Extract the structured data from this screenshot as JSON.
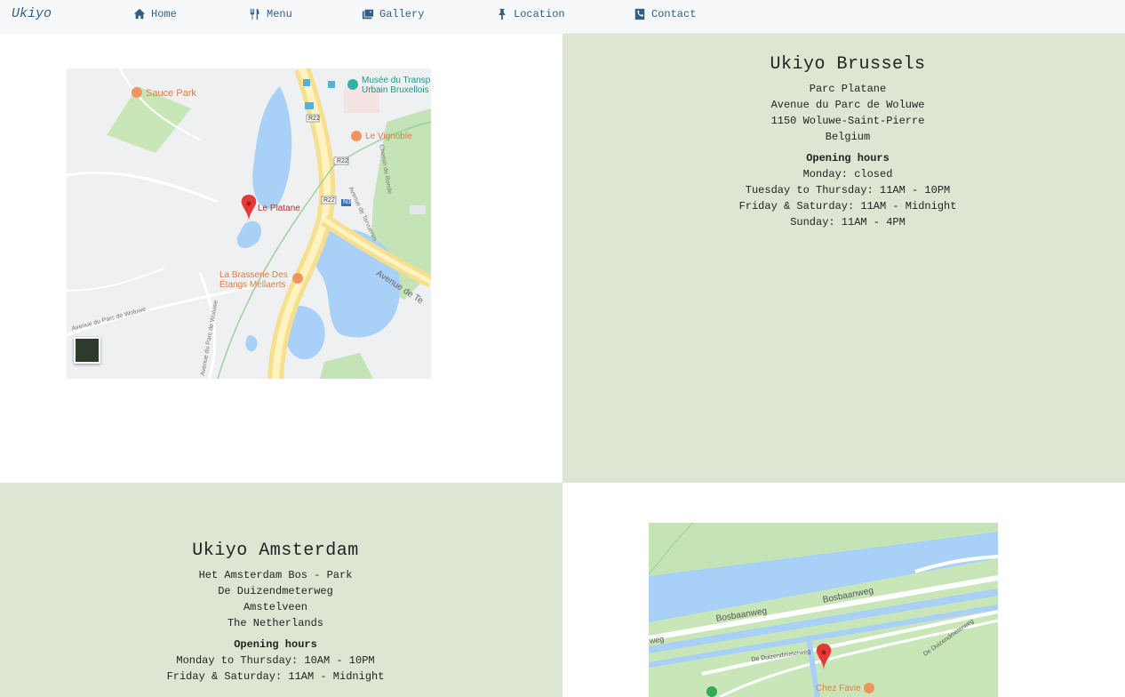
{
  "nav": {
    "brand": "Ukiyo",
    "items": [
      {
        "label": "Home",
        "icon": "home-icon"
      },
      {
        "label": "Menu",
        "icon": "utensils-icon"
      },
      {
        "label": "Gallery",
        "icon": "images-icon"
      },
      {
        "label": "Location",
        "icon": "pin-icon"
      },
      {
        "label": "Contact",
        "icon": "phone-icon"
      }
    ]
  },
  "brussels": {
    "title": "Ukiyo Brussels",
    "address": [
      "Parc Platane",
      "Avenue du Parc de Woluwe",
      "1150 Woluwe-Saint-Pierre",
      "Belgium"
    ],
    "hours_title": "Opening hours",
    "hours": [
      "Monday: closed",
      "Tuesday to Thursday: 11AM - 10PM",
      "Friday & Saturday: 11AM - Midnight",
      "Sunday: 11AM - 4PM"
    ],
    "map": {
      "labels": {
        "sauce_park": "Sauce Park",
        "musee": "Musée du Transp",
        "musee2": "Urbain Bruxellois",
        "vignoble": "Le Vignoble",
        "platane": "Le Platane",
        "brasserie1": "La Brasserie Des",
        "brasserie2": "Étangs Mellaerts",
        "r22a": "R22",
        "r22b": "R22",
        "r22c": "R22",
        "n3": "N3",
        "avenue_tervueren": "Avenue de Te",
        "av_tervueren_small": "Avenue de Tervueren",
        "av_parc_woluwe": "Avenue du Parc de Woluwe",
        "av_parc_woluwe2": "Avenue du Parc de Woluwe",
        "chemin_ronde": "Chemin de Ronde"
      }
    }
  },
  "amsterdam": {
    "title": "Ukiyo Amsterdam",
    "address": [
      "Het Amsterdam Bos - Park",
      "De Duizendmeterweg",
      "Amstelveen",
      "The Netherlands"
    ],
    "hours_title": "Opening hours",
    "hours": [
      "Monday to Thursday: 10AM - 10PM",
      "Friday & Saturday: 11AM - Midnight"
    ],
    "map": {
      "labels": {
        "bosbaanweg1": "Bosbaanweg",
        "bosbaanweg2": "Bosbaanweg",
        "weg": "weg",
        "duizend1": "De Duizendmeterweg",
        "duizend2": "De Duizendmeterweg",
        "chez": "Chez Favie"
      }
    }
  }
}
